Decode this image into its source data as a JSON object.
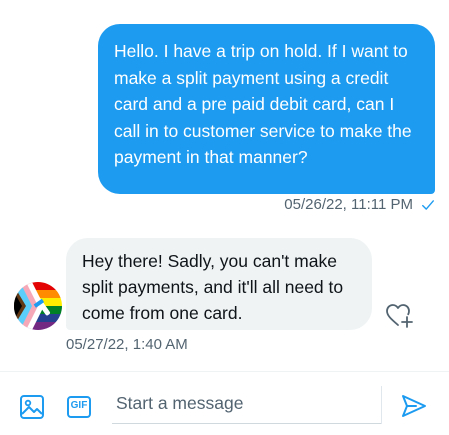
{
  "conversation": {
    "outgoing": {
      "text": "Hello. I have a trip on hold.  If I want to make a split payment using a credit card and a pre paid debit card, can I call in to customer service to make the payment  in that manner?",
      "timestamp": "05/26/22, 11:11 PM",
      "status_icon": "check-icon"
    },
    "incoming": {
      "text": "Hey there! Sadly, you can't make split payments, and it'll all need to come from one card.",
      "timestamp": "05/27/22, 1:40 AM",
      "avatar_icon": "pride-flag-avatar",
      "reaction_icon": "heart-plus-icon"
    }
  },
  "composer": {
    "placeholder": "Start a message",
    "value": "",
    "media_icon": "image-icon",
    "gif_label": "GIF",
    "send_icon": "send-icon"
  },
  "colors": {
    "accent": "#1d9bf0",
    "incoming_bubble": "#eff3f4",
    "muted_text": "#536471"
  }
}
